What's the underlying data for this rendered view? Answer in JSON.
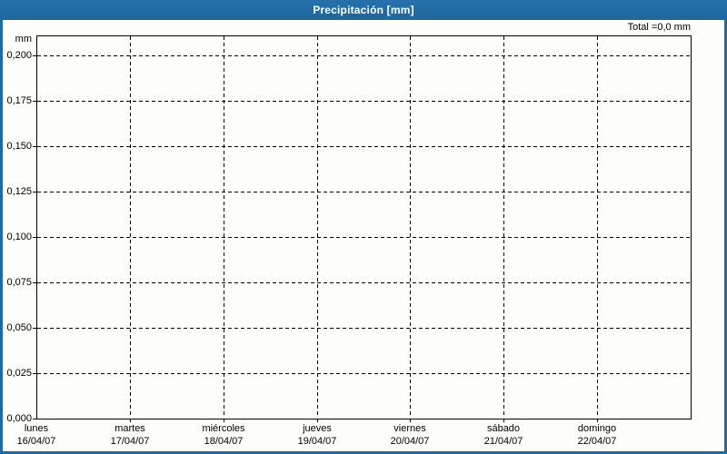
{
  "header": {
    "title": "Precipitación [mm]"
  },
  "chart": {
    "total_label": "Total =0,0 mm",
    "unit_label": "mm"
  },
  "colors": {
    "titlebar_blue": "#1e6ba3",
    "frame_blue": "#1e6ba3",
    "plot_background": "#fdfefa",
    "grid_color": "#000000",
    "title_text": "#ffffff",
    "label_text": "#000000"
  },
  "chart_data": {
    "type": "line",
    "title": "Precipitación [mm]",
    "ylabel": "mm",
    "ylim": [
      0,
      0.2105
    ],
    "grid": true,
    "legend_position": "none",
    "yticks": [
      {
        "value": 0.2,
        "label": "0,200"
      },
      {
        "value": 0.175,
        "label": "0,175"
      },
      {
        "value": 0.15,
        "label": "0,150"
      },
      {
        "value": 0.125,
        "label": "0,125"
      },
      {
        "value": 0.1,
        "label": "0,100"
      },
      {
        "value": 0.075,
        "label": "0,075"
      },
      {
        "value": 0.05,
        "label": "0,050"
      },
      {
        "value": 0.025,
        "label": "0,025"
      },
      {
        "value": 0.0,
        "label": "0,000"
      }
    ],
    "categories": [
      {
        "day": "lunes",
        "date": "16/04/07"
      },
      {
        "day": "martes",
        "date": "17/04/07"
      },
      {
        "day": "miércoles",
        "date": "18/04/07"
      },
      {
        "day": "jueves",
        "date": "19/04/07"
      },
      {
        "day": "viernes",
        "date": "20/04/07"
      },
      {
        "day": "sábado",
        "date": "21/04/07"
      },
      {
        "day": "domingo",
        "date": "22/04/07"
      }
    ],
    "series": [
      {
        "name": "Precipitación",
        "values": [
          0,
          0,
          0,
          0,
          0,
          0,
          0
        ]
      }
    ],
    "total_text": "Total =0,0 mm"
  }
}
